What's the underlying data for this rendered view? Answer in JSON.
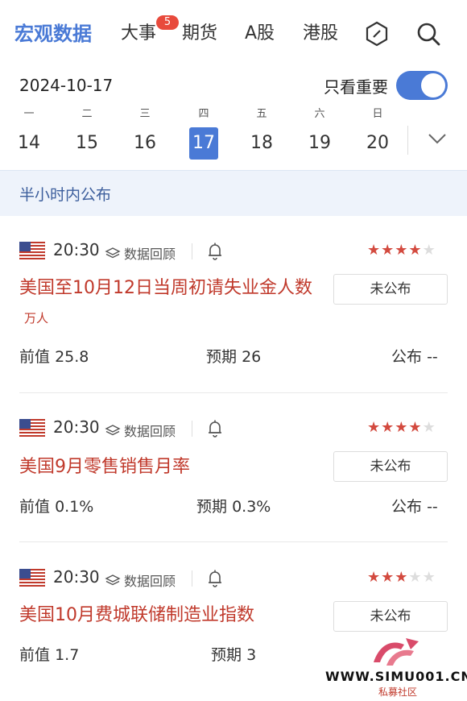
{
  "nav": {
    "tabs": [
      "宏观数据",
      "大事",
      "期货",
      "A股",
      "港股"
    ],
    "badge": "5",
    "active_color": "#4a7ad6"
  },
  "date_bar": {
    "date": "2024-10-17",
    "only_important_label": "只看重要",
    "toggle_on": true
  },
  "week": [
    {
      "weekday": "一",
      "day": "14"
    },
    {
      "weekday": "二",
      "day": "15"
    },
    {
      "weekday": "三",
      "day": "16"
    },
    {
      "weekday": "四",
      "day": "17"
    },
    {
      "weekday": "五",
      "day": "18"
    },
    {
      "weekday": "六",
      "day": "19"
    },
    {
      "weekday": "日",
      "day": "20"
    }
  ],
  "section_title": "半小时内公布",
  "items": [
    {
      "flag": "us-flag-icon",
      "time": "20:30",
      "review_label": "数据回顾",
      "stars": 4,
      "title": "美国至10月12日当周初请失业金人数",
      "unit": "万人",
      "status": "未公布",
      "prev_label": "前值",
      "prev": "25.8",
      "exp_label": "预期",
      "exp": "26",
      "pub_label": "公布",
      "pub": "--"
    },
    {
      "flag": "us-flag-icon",
      "time": "20:30",
      "review_label": "数据回顾",
      "stars": 4,
      "title": "美国9月零售销售月率",
      "unit": "",
      "status": "未公布",
      "prev_label": "前值",
      "prev": "0.1%",
      "exp_label": "预期",
      "exp": "0.3%",
      "pub_label": "公布",
      "pub": "--"
    },
    {
      "flag": "us-flag-icon",
      "time": "20:30",
      "review_label": "数据回顾",
      "stars": 3,
      "title": "美国10月费城联储制造业指数",
      "unit": "",
      "status": "未公布",
      "prev_label": "前值",
      "prev": "1.7",
      "exp_label": "预期",
      "exp": "3",
      "pub_label": "",
      "pub": ""
    }
  ],
  "watermark": {
    "text": "WWW.SIMU001.CN",
    "sub": "私募社区"
  }
}
